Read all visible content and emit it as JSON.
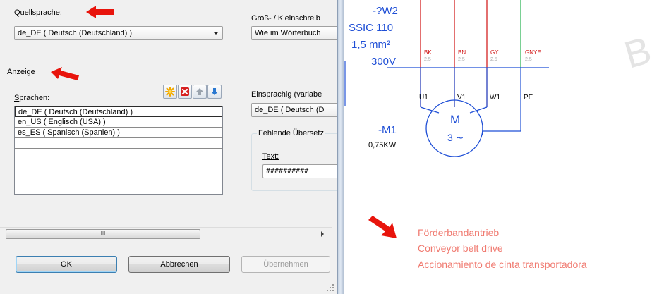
{
  "dialog": {
    "source_language": {
      "label": "Quellsprache:",
      "value": "de_DE ( Deutsch (Deutschland) )"
    },
    "case": {
      "label": "Groß- / Kleinschreib",
      "value": "Wie im Wörterbuch"
    },
    "display_group": "Anzeige",
    "languages_label": "Sprachen:",
    "languages": [
      "de_DE ( Deutsch (Deutschland) )",
      "en_US ( Englisch (USA) )",
      "es_ES ( Spanisch (Spanien) )"
    ],
    "monolingual": {
      "label": "Einsprachig (variabe",
      "value": "de_DE ( Deutsch (D"
    },
    "missing_translation": {
      "group": "Fehlende Übersetz",
      "text_label": "Text:",
      "text_value": "##########"
    },
    "scroll_thumb": "III",
    "buttons": {
      "ok": "OK",
      "cancel": "Abbrechen",
      "apply": "Übernehmen"
    },
    "icons": {
      "new": "star-icon",
      "delete": "red-x-icon",
      "up": "arrow-up-icon",
      "down": "arrow-down-icon"
    }
  },
  "schematic": {
    "cable_id": "-?W2",
    "cable_type": "SSIC 110",
    "cross_section": "1,5 mm²",
    "voltage": "300V",
    "wires": [
      {
        "color_code": "BK",
        "size": "2,5"
      },
      {
        "color_code": "BN",
        "size": "2,5"
      },
      {
        "color_code": "GY",
        "size": "2,5"
      },
      {
        "color_code": "GNYE",
        "size": "2,5"
      }
    ],
    "terminals": [
      "U1",
      "V1",
      "W1",
      "PE"
    ],
    "motor": {
      "id": "-M1",
      "power": "0,75KW",
      "symbol": "M",
      "phase": "3 ∼"
    },
    "watermark": "B",
    "description": [
      "Förderbandantrieb",
      "Conveyor belt drive",
      "Accionamiento de cinta transportadora"
    ],
    "colors": {
      "wire_red": "#d01010",
      "wire_green": "#22b14c",
      "blue": "#1f4fd6",
      "note": "#f07a70",
      "arrow": "#e8140c"
    }
  }
}
